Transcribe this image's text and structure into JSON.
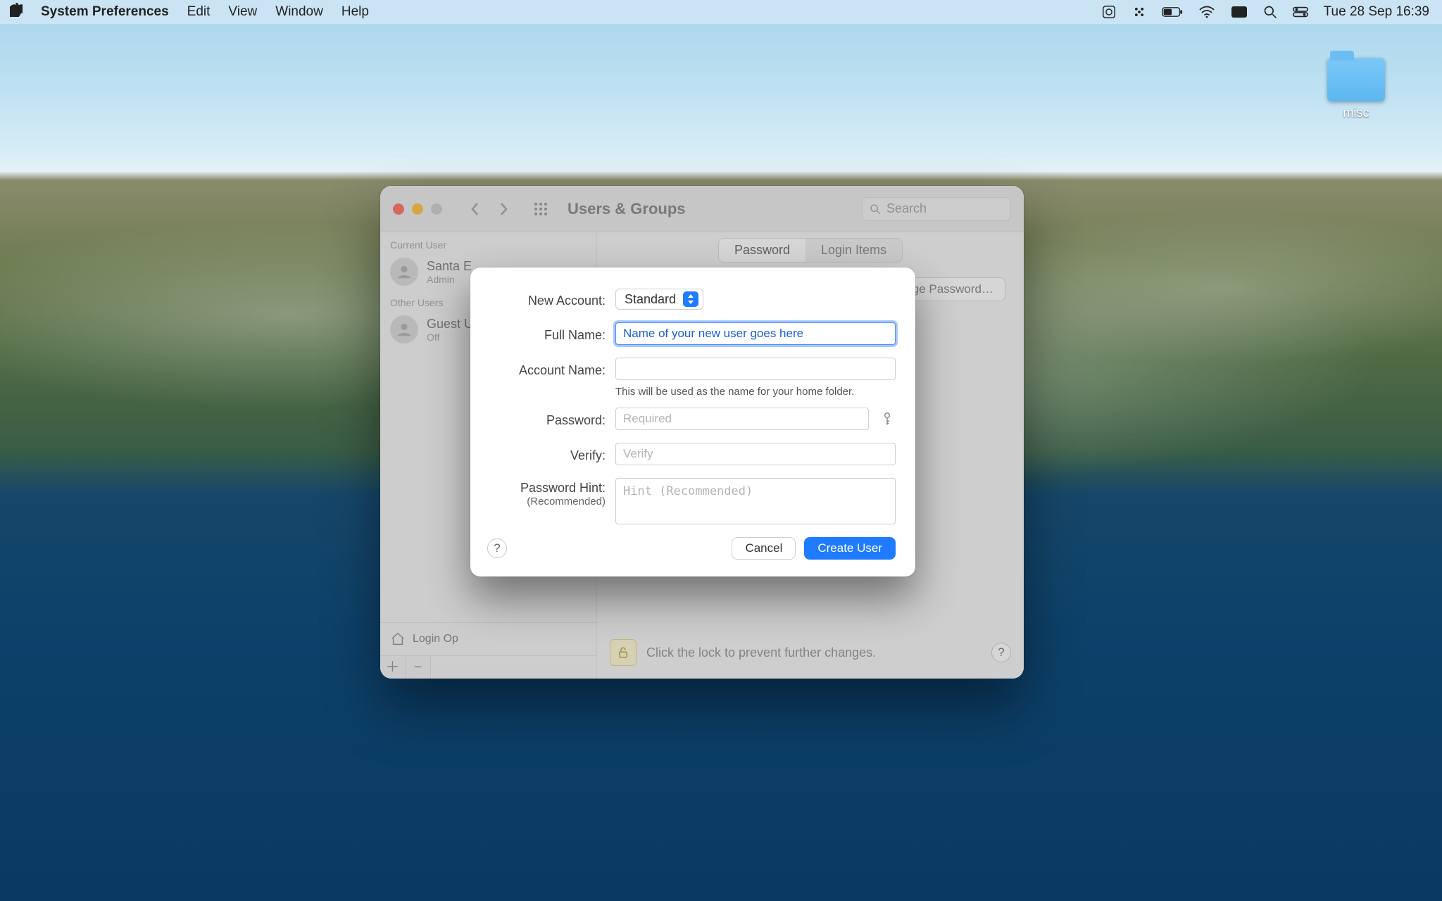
{
  "menubar": {
    "app_name": "System Preferences",
    "items": [
      "Edit",
      "View",
      "Window",
      "Help"
    ],
    "clock": "Tue 28 Sep  16:39"
  },
  "desktop": {
    "folder_label": "misc"
  },
  "window": {
    "title": "Users & Groups",
    "search_placeholder": "Search",
    "tabs": {
      "password": "Password",
      "login_items": "Login Items"
    },
    "change_password_btn": "Change Password…",
    "sidebar": {
      "current_label": "Current User",
      "other_label": "Other Users",
      "current_user": {
        "name": "Santa E",
        "role": "Admin"
      },
      "guest_user": {
        "name": "Guest U",
        "role": "Off"
      },
      "login_options": "Login Op"
    },
    "lock_text": "Click the lock to prevent further changes."
  },
  "sheet": {
    "labels": {
      "new_account": "New Account:",
      "full_name": "Full Name:",
      "account_name": "Account Name:",
      "password": "Password:",
      "verify": "Verify:",
      "password_hint": "Password Hint:",
      "password_hint_sub": "(Recommended)"
    },
    "account_type_value": "Standard",
    "full_name_value": "Name of your new user goes here",
    "account_name_hint": "This will be used as the name for your home folder.",
    "password_placeholder": "Required",
    "verify_placeholder": "Verify",
    "hint_placeholder": "Hint (Recommended)",
    "cancel": "Cancel",
    "create": "Create User"
  }
}
